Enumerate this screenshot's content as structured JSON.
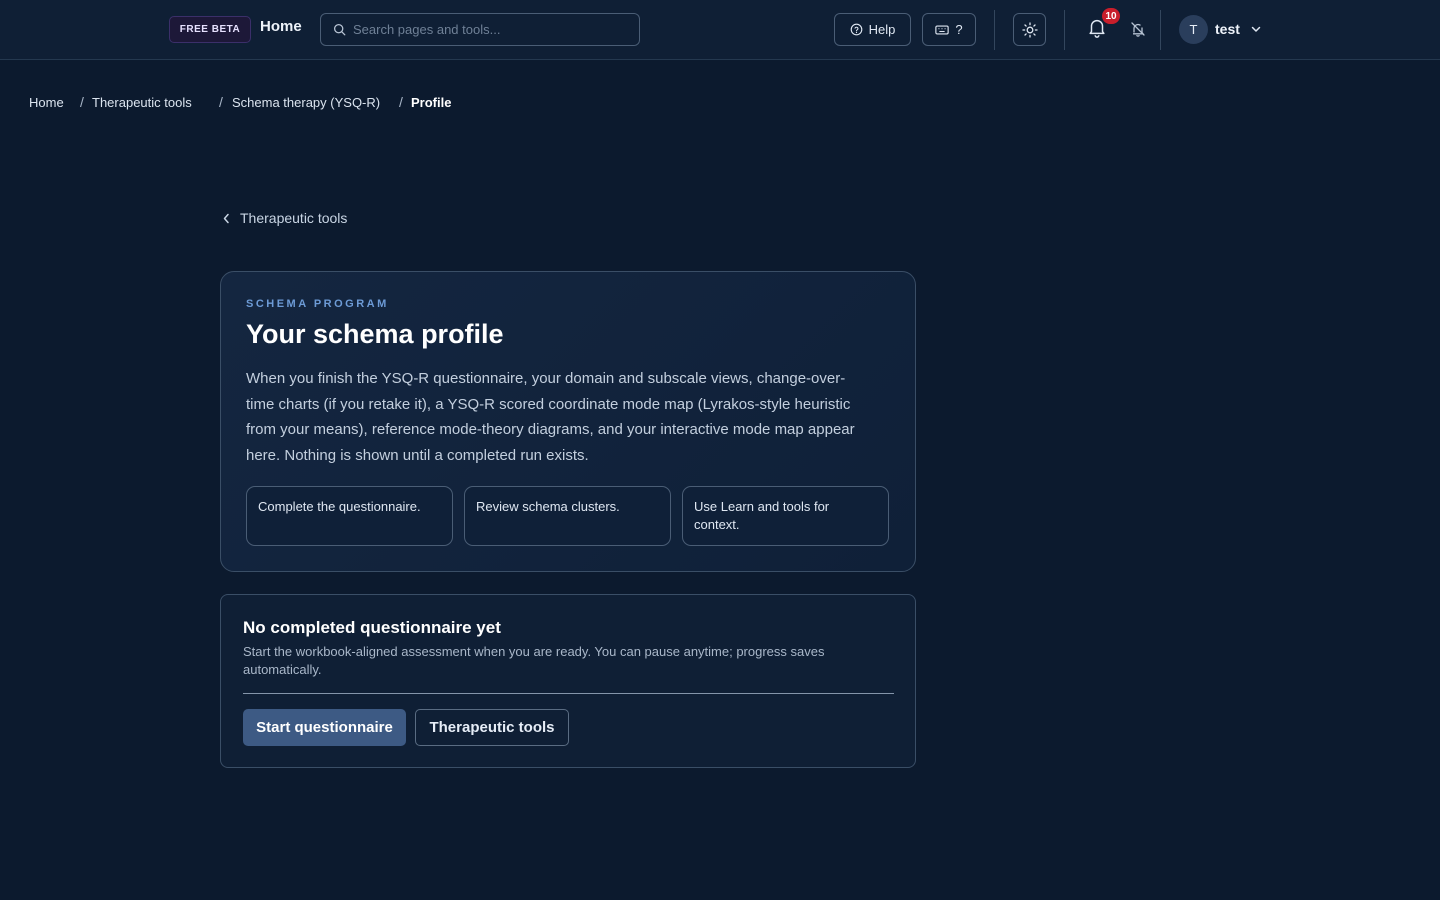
{
  "header": {
    "beta_badge": "FREE BETA",
    "home_label": "Home",
    "search_placeholder": "Search pages and tools...",
    "help_label": "Help",
    "shortcuts_label": "?",
    "notification_count": "10",
    "user_initial": "T",
    "username": "test"
  },
  "breadcrumb": {
    "items": [
      "Home",
      "Therapeutic tools",
      "Schema therapy (YSQ-R)",
      "Profile"
    ],
    "separator": "/"
  },
  "back_link": "Therapeutic tools",
  "intro_card": {
    "eyebrow": "SCHEMA PROGRAM",
    "title": "Your schema profile",
    "description": "When you finish the YSQ-R questionnaire, your domain and subscale views, change-over-time charts (if you retake it), a YSQ-R scored coordinate mode map (Lyrakos-style heuristic from your means), reference mode-theory diagrams, and your interactive mode map appear here. Nothing is shown until a completed run exists.",
    "steps": [
      "Complete the questionnaire.",
      "Review schema clusters.",
      "Use Learn and tools for context."
    ]
  },
  "status_card": {
    "title": "No completed questionnaire yet",
    "description": "Start the workbook-aligned assessment when you are ready. You can pause anytime; progress saves automatically.",
    "primary_button": "Start questionnaire",
    "secondary_button": "Therapeutic tools"
  },
  "colors": {
    "background": "#0c1a2e",
    "primary_button": "#3d5a84",
    "eyebrow": "#6d9bd6",
    "badge": "#c81e2b"
  },
  "icons": [
    "search-icon",
    "help-circle-icon",
    "keyboard-icon",
    "sun-icon",
    "bell-icon",
    "bell-off-icon",
    "chevron-down-icon",
    "chevron-left-icon"
  ]
}
